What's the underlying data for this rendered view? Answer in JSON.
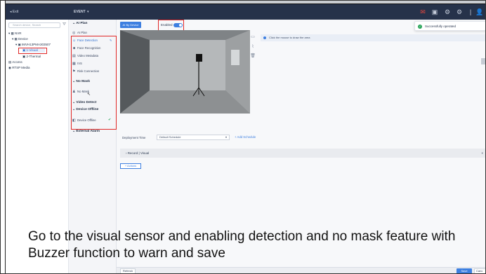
{
  "topbar": {
    "back_label": "◂ Exit",
    "title": "EVENT",
    "title_chevron": "▾",
    "icons": [
      "bell-icon",
      "monitor-icon",
      "gear-icon",
      "settings-icon",
      "user-icon"
    ]
  },
  "tree": {
    "search_placeholder": "Search device, Search",
    "items": [
      "NVR",
      "Device",
      "IMVH13PMA303507",
      "1-Visual",
      "2-Thermal",
      "Access",
      "RTSP Media"
    ]
  },
  "sidemenu": {
    "ai_plan": "AI Plan",
    "ai_items": [
      "AI Plan",
      "Face Detection",
      "Face Recognition",
      "Video Metadata",
      "IVS",
      "Risk Connection"
    ],
    "no_mask": "No Mask",
    "no_mask_item": "No Mask",
    "video_detect": "Video Detect",
    "device_offline": "Device Offline",
    "device_offline_item": "Device Offline",
    "external_alarm": "External Alarm"
  },
  "content": {
    "ai_by_device": "AI By Device",
    "enabled_label": "Enabled",
    "info_text": "Click the mouse to draw the area",
    "deployment_label": "Deployment Time",
    "schedule_value": "Default Schedule",
    "add_schedule": "+ Add Schedule",
    "record_label": "Record | Visual",
    "actions_label": "+ Actions",
    "refresh_label": "Refresh",
    "save_label": "Save",
    "cancel_label": "Canc"
  },
  "toast": {
    "text": "Successfully operated"
  },
  "subtitle": {
    "line1": "Go to the visual sensor and enabling detection and no mask feature with",
    "line2": "Buzzer function to warn and save"
  },
  "colors": {
    "accent": "#3d7fe0",
    "highlight": "#e02727",
    "topbar": "#26324a",
    "success": "#2aa55a"
  }
}
